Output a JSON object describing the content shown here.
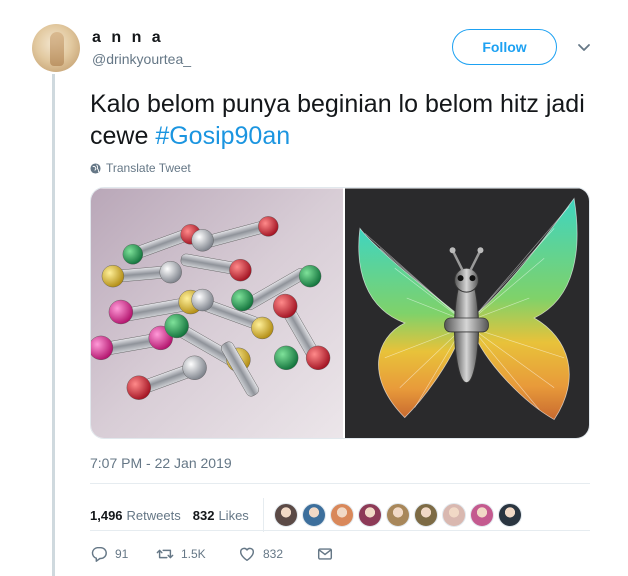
{
  "tweet": {
    "author_name": "a n n a",
    "author_handle": "@drinkyourtea_",
    "follow_label": "Follow",
    "text_main": "Kalo belom punya beginian lo belom hitz jadi cewe ",
    "hashtag": "#Gosip90an",
    "translate_label": "Translate Tweet",
    "timestamp": "7:07 PM - 22 Jan 2019"
  },
  "stats": {
    "retweets_count": "1,496",
    "retweets_label": "Retweets",
    "likes_count": "832",
    "likes_label": "Likes",
    "liker_avatar_colors": [
      "#5b4a46",
      "#3d6f9c",
      "#d9885a",
      "#8d3a57",
      "#a8875a",
      "#7d6b45",
      "#d9b8b0",
      "#c45a8f",
      "#2a3540"
    ]
  },
  "actions": {
    "reply_count": "91",
    "retweet_count": "1.5K",
    "like_count": "832"
  },
  "icons": {
    "chevron": "chevron-down-icon",
    "translate": "globe-icon",
    "reply": "reply-icon",
    "retweet": "retweet-icon",
    "like": "heart-icon",
    "dm": "envelope-icon"
  },
  "colors": {
    "accent": "#1da1f2",
    "hashtag": "#1b95e0",
    "muted": "#657786"
  }
}
